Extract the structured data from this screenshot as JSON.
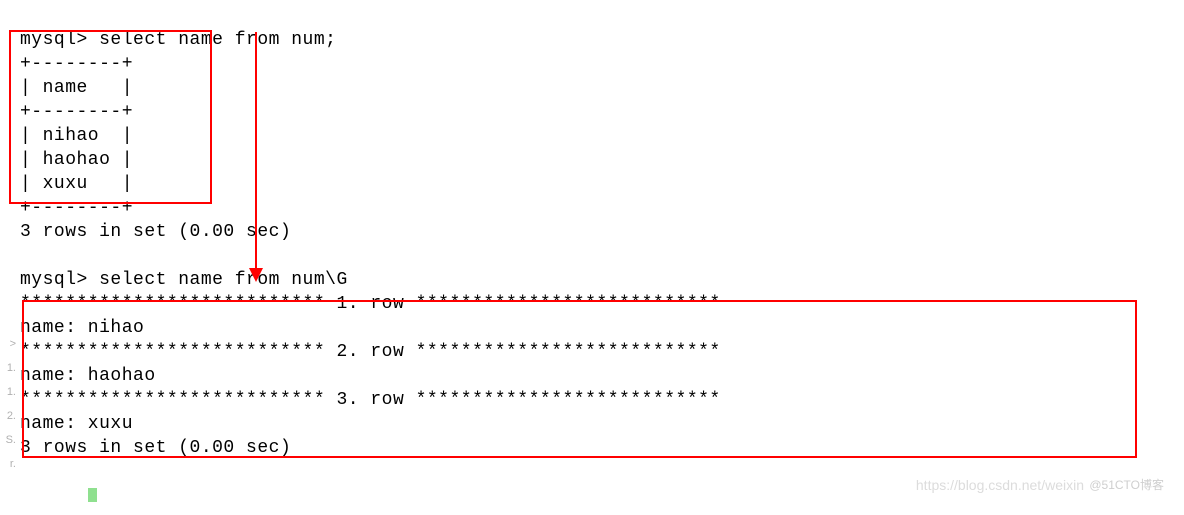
{
  "terminal": {
    "prompt": "mysql>",
    "query1": "select name from num;",
    "query2": "select name from num\\G",
    "table": {
      "border": "+--------+",
      "header": "| name   |",
      "rows": [
        "| nihao  |",
        "| haohao |",
        "| xuxu   |"
      ]
    },
    "status": "3 rows in set (0.00 sec)",
    "rowDelimPrefix": "***************************",
    "rowDelimSuffix": "***************************",
    "rows": [
      {
        "idx": "1",
        "label": " 1. row "
      },
      {
        "idx": "2",
        "label": " 2. row "
      },
      {
        "idx": "3",
        "label": " 3. row "
      }
    ],
    "fields": [
      "name: nihao",
      "name: haohao",
      "name: xuxu"
    ]
  },
  "gutter": {
    "items": [
      "",
      ">",
      "1.",
      "1.",
      "2.",
      "S.",
      "r."
    ]
  },
  "watermarks": {
    "csdn": "https://blog.csdn.net/weixin",
    "cto": "@51CTO博客"
  }
}
